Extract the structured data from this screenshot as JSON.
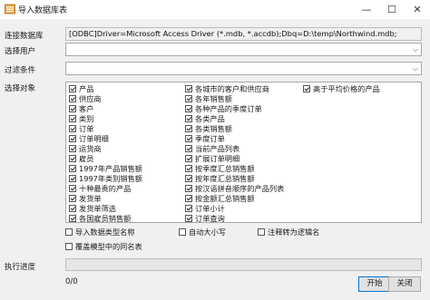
{
  "window": {
    "title": "导入数据库表",
    "minimize": "—",
    "maximize": "☐",
    "close": "✕"
  },
  "form": {
    "conn_label": "连接数据库",
    "conn_value": "[ODBC]Driver=Microsoft Access Driver (*.mdb, *.accdb);Dbq=D:\\temp\\Northwind.mdb;",
    "user_label": "选择用户",
    "user_value": "",
    "filter_label": "过滤条件",
    "filter_value": "",
    "objects_label": "选择对象"
  },
  "objects": {
    "col1": [
      {
        "label": "产品",
        "checked": true
      },
      {
        "label": "供应商",
        "checked": true
      },
      {
        "label": "客户",
        "checked": true
      },
      {
        "label": "类别",
        "checked": true
      },
      {
        "label": "订单",
        "checked": true
      },
      {
        "label": "订单明细",
        "checked": true
      },
      {
        "label": "运货商",
        "checked": true
      },
      {
        "label": "雇员",
        "checked": true
      },
      {
        "label": "1997年产品销售额",
        "checked": true
      },
      {
        "label": "1997年类别销售额",
        "checked": true
      },
      {
        "label": "十种最贵的产品",
        "checked": true
      },
      {
        "label": "发货单",
        "checked": true
      },
      {
        "label": "发货单筛选",
        "checked": true
      },
      {
        "label": "各国雇员销售额",
        "checked": true
      }
    ],
    "col2": [
      {
        "label": "各城市的客户和供应商",
        "checked": true
      },
      {
        "label": "各年销售额",
        "checked": true
      },
      {
        "label": "各种产品的季度订单",
        "checked": true
      },
      {
        "label": "各类产品",
        "checked": true
      },
      {
        "label": "各类销售额",
        "checked": true
      },
      {
        "label": "季度订单",
        "checked": true
      },
      {
        "label": "当前产品列表",
        "checked": true
      },
      {
        "label": "扩展订单明细",
        "checked": true
      },
      {
        "label": "按季度汇总销售额",
        "checked": true
      },
      {
        "label": "按年度汇总销售额",
        "checked": true
      },
      {
        "label": "按汉语拼音顺序的产品列表",
        "checked": true
      },
      {
        "label": "按金额汇总销售额",
        "checked": true
      },
      {
        "label": "订单小计",
        "checked": true
      },
      {
        "label": "订单查询",
        "checked": true
      }
    ],
    "col3": [
      {
        "label": "高于平均价格的产品",
        "checked": true
      }
    ]
  },
  "options": {
    "import_types": "导入数据类型名称",
    "auto_size": "自动大小写",
    "comment_logical": "注释转为逻辑名",
    "overwrite_same": "覆盖模型中的同名表"
  },
  "progress": {
    "label": "执行进度",
    "value": 0,
    "status": "0/0"
  },
  "buttons": {
    "start": "开始",
    "close": "关闭"
  },
  "colors": {
    "progress_fill": "#06b025",
    "primary_border": "#0078d7"
  }
}
